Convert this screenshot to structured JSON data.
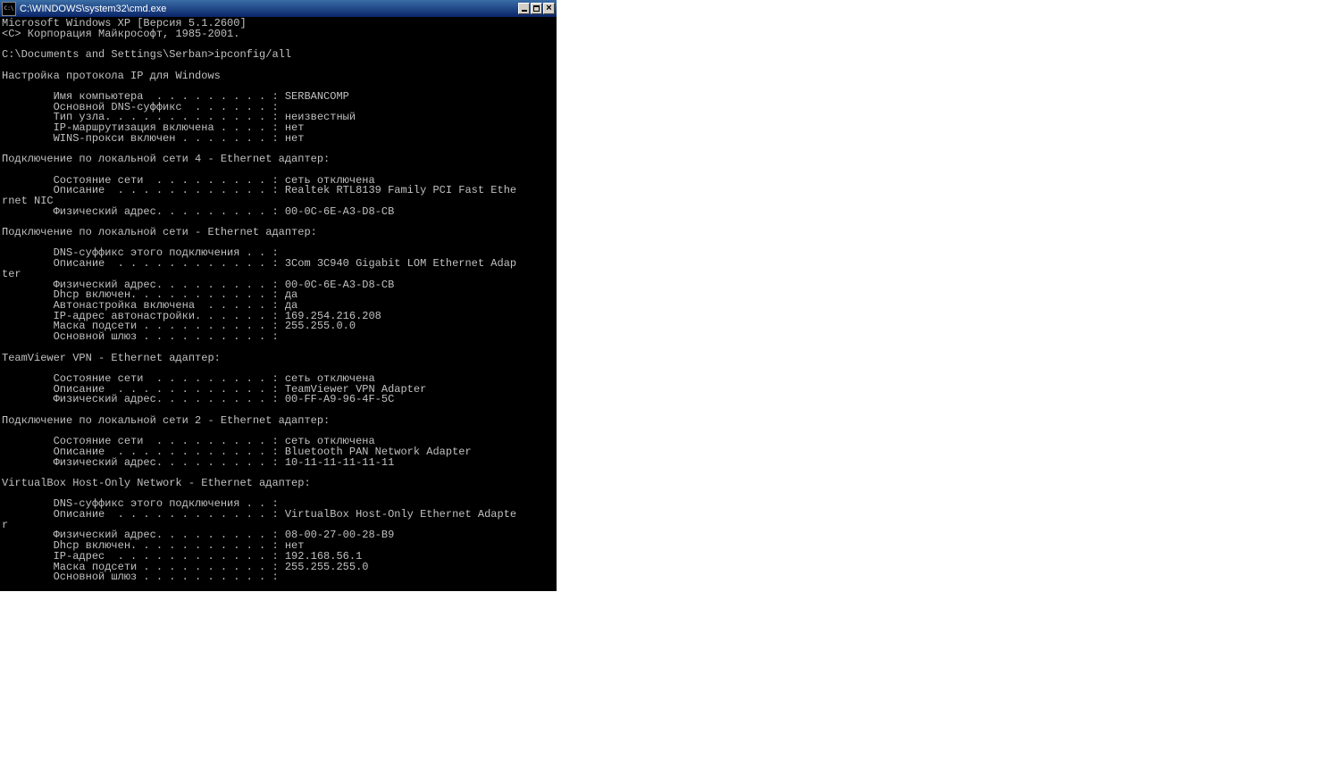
{
  "window": {
    "title": "C:\\WINDOWS\\system32\\cmd.exe"
  },
  "console": {
    "lines": [
      "Microsoft Windows XP [Версия 5.1.2600]",
      "<C> Корпорация Майкрософт, 1985-2001.",
      "",
      "C:\\Documents and Settings\\Serban>ipconfig/all",
      "",
      "Настройка протокола IP для Windows",
      "",
      "        Имя компьютера  . . . . . . . . . : SERBANCOMP",
      "        Основной DNS-суффикс  . . . . . . :",
      "        Тип узла. . . . . . . . . . . . . : неизвестный",
      "        IP-маршрутизация включена . . . . : нет",
      "        WINS-прокси включен . . . . . . . : нет",
      "",
      "Подключение по локальной сети 4 - Ethernet адаптер:",
      "",
      "        Состояние сети  . . . . . . . . . : сеть отключена",
      "        Описание  . . . . . . . . . . . . : Realtek RTL8139 Family PCI Fast Ethe",
      "rnet NIC",
      "        Физический адрес. . . . . . . . . : 00-0C-6E-A3-D8-CB",
      "",
      "Подключение по локальной сети - Ethernet адаптер:",
      "",
      "        DNS-суффикс этого подключения . . :",
      "        Описание  . . . . . . . . . . . . : 3Com 3C940 Gigabit LOM Ethernet Adap",
      "ter",
      "        Физический адрес. . . . . . . . . : 00-0C-6E-A3-D8-CB",
      "        Dhcp включен. . . . . . . . . . . : да",
      "        Автонастройка включена  . . . . . : да",
      "        IP-адрес автонастройки. . . . . . : 169.254.216.208",
      "        Маска подсети . . . . . . . . . . : 255.255.0.0",
      "        Основной шлюз . . . . . . . . . . :",
      "",
      "TeamViewer VPN - Ethernet адаптер:",
      "",
      "        Состояние сети  . . . . . . . . . : сеть отключена",
      "        Описание  . . . . . . . . . . . . : TeamViewer VPN Adapter",
      "        Физический адрес. . . . . . . . . : 00-FF-A9-96-4F-5C",
      "",
      "Подключение по локальной сети 2 - Ethernet адаптер:",
      "",
      "        Состояние сети  . . . . . . . . . : сеть отключена",
      "        Описание  . . . . . . . . . . . . : Bluetooth PAN Network Adapter",
      "        Физический адрес. . . . . . . . . : 10-11-11-11-11-11",
      "",
      "VirtualBox Host-Only Network - Ethernet адаптер:",
      "",
      "        DNS-суффикс этого подключения . . :",
      "        Описание  . . . . . . . . . . . . : VirtualBox Host-Only Ethernet Adapte",
      "r",
      "        Физический адрес. . . . . . . . . : 08-00-27-00-28-B9",
      "        Dhcp включен. . . . . . . . . . . : нет",
      "        IP-адрес  . . . . . . . . . . . . : 192.168.56.1",
      "        Маска подсети . . . . . . . . . . : 255.255.255.0",
      "        Основной шлюз . . . . . . . . . . :"
    ]
  }
}
